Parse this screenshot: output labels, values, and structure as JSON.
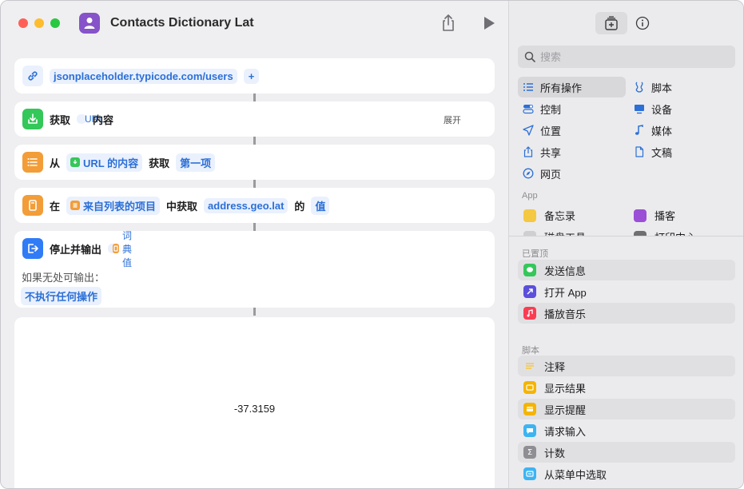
{
  "window": {
    "title": "Contacts Dictionary Lat"
  },
  "actions": {
    "url": {
      "value": "jsonplaceholder.typicode.com/users",
      "add_symbol": "+"
    },
    "get_contents": {
      "verb": "获取",
      "token": "URL",
      "suffix": "内容",
      "expand": "展开"
    },
    "get_item": {
      "from": "从",
      "token": "URL 的内容",
      "verb": "获取",
      "value": "第一项"
    },
    "get_dict_value": {
      "prefix": "在",
      "token": "来自列表的项目",
      "middle": "中获取",
      "key": "address.geo.lat",
      "of": "的",
      "value": "值"
    },
    "stop_output": {
      "label": "停止并输出",
      "token": "词典值",
      "if_none_label": "如果无处可输出：",
      "if_none_value": "不执行任何操作"
    }
  },
  "result": {
    "value": "-37.3159"
  },
  "library": {
    "search_placeholder": "搜索",
    "categories": {
      "all": "所有操作",
      "scripting": "脚本",
      "control": "控制",
      "device": "设备",
      "location": "位置",
      "media": "媒体",
      "sharing": "共享",
      "documents": "文稿",
      "web": "网页"
    },
    "apps_label": "App",
    "apps": [
      {
        "name": "备忘录",
        "color": "#f5c842"
      },
      {
        "name": "播客",
        "color": "#9b4fd6"
      },
      {
        "name": "磁盘工具",
        "color": "#cfcfd2"
      },
      {
        "name": "打印中心",
        "color": "#6e6e73"
      }
    ],
    "pinned_label": "已置顶",
    "pinned": [
      {
        "name": "发送信息",
        "color": "#34c759"
      },
      {
        "name": "打开 App",
        "color": "#5b4fdc"
      },
      {
        "name": "播放音乐",
        "color": "#fa3c52"
      }
    ],
    "scripting_label": "脚本",
    "scripting": [
      {
        "name": "注释",
        "color": "#f5c842"
      },
      {
        "name": "显示结果",
        "color": "#f5b400"
      },
      {
        "name": "显示提醒",
        "color": "#f5b400"
      },
      {
        "name": "请求输入",
        "color": "#3db4f2"
      },
      {
        "name": "计数",
        "color": "#8e8e93"
      },
      {
        "name": "从菜单中选取",
        "color": "#3db4f2"
      }
    ]
  }
}
